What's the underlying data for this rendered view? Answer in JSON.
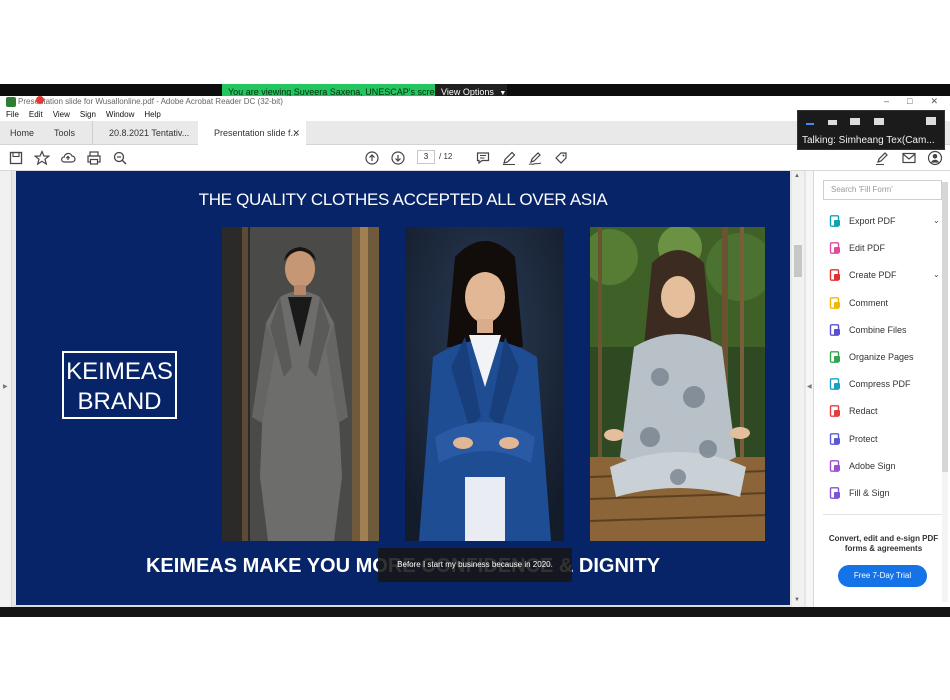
{
  "zoom": {
    "viewing_banner": "You are viewing Suveera Saxena, UNESCAP's screen",
    "view_options_label": "View Options",
    "talking_label": "Talking: Simheang Tex(Cam..."
  },
  "window": {
    "title": "Presentation slide for Wusallonline.pdf - Adobe Acrobat Reader DC (32-bit)",
    "controls": [
      "–",
      "□",
      "✕"
    ]
  },
  "menu": [
    "File",
    "Edit",
    "View",
    "Sign",
    "Window",
    "Help"
  ],
  "tabs": {
    "home": "Home",
    "tools": "Tools",
    "doc1": "20.8.2021 Tentativ...",
    "doc2": "Presentation slide f..."
  },
  "toolbar": {
    "current_page": "3",
    "total_pages": "/ 12"
  },
  "slide": {
    "title": "THE QUALITY CLOTHES ACCEPTED ALL OVER ASIA",
    "brand_line1": "KEIMEAS",
    "brand_line2": "BRAND",
    "tagline": "KEIMEAS MAKE YOU MORE CONFIDENCE & DIGNITY",
    "caption": "Before I start my business because in 2020."
  },
  "tools_pane": {
    "search_placeholder": "Search 'Fill Form'",
    "items": [
      {
        "label": "Export PDF",
        "icon": "export-pdf-icon",
        "color": "#0fa3b1",
        "dropdown": true
      },
      {
        "label": "Edit PDF",
        "icon": "edit-pdf-icon",
        "color": "#e04a9a",
        "dropdown": false
      },
      {
        "label": "Create PDF",
        "icon": "create-pdf-icon",
        "color": "#e0302f",
        "dropdown": true
      },
      {
        "label": "Comment",
        "icon": "comment-icon",
        "color": "#f2b705",
        "dropdown": false
      },
      {
        "label": "Combine Files",
        "icon": "combine-files-icon",
        "color": "#5a4fcf",
        "dropdown": false
      },
      {
        "label": "Organize Pages",
        "icon": "organize-pages-icon",
        "color": "#37a350",
        "dropdown": false
      },
      {
        "label": "Compress PDF",
        "icon": "compress-pdf-icon",
        "color": "#1aa0c6",
        "dropdown": false
      },
      {
        "label": "Redact",
        "icon": "redact-icon",
        "color": "#e03e3e",
        "dropdown": false
      },
      {
        "label": "Protect",
        "icon": "protect-icon",
        "color": "#5a58d6",
        "dropdown": false
      },
      {
        "label": "Adobe Sign",
        "icon": "adobe-sign-icon",
        "color": "#9b4fd1",
        "dropdown": false
      },
      {
        "label": "Fill & Sign",
        "icon": "fill-sign-icon",
        "color": "#7e53d4",
        "dropdown": false
      }
    ],
    "promo_text": "Convert, edit and e-sign PDF forms & agreements",
    "trial_button": "Free 7-Day Trial"
  }
}
